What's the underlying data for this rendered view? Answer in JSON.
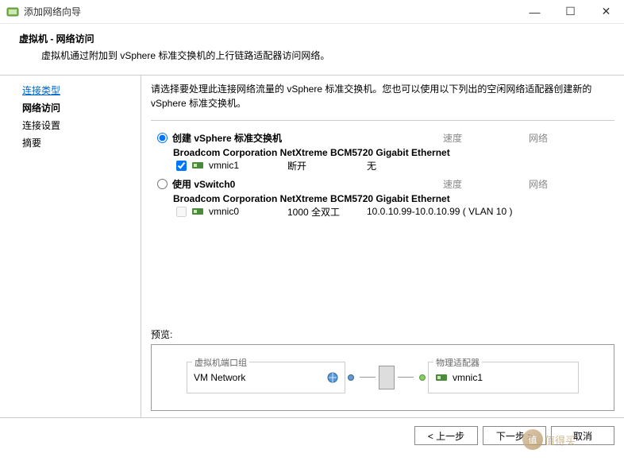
{
  "window": {
    "title": "添加网络向导",
    "minimize": "—",
    "maximize": "☐",
    "close": "✕"
  },
  "header": {
    "title": "虚拟机 - 网络访问",
    "description": "虚拟机通过附加到 vSphere 标准交换机的上行链路适配器访问网络。"
  },
  "sidebar": {
    "items": [
      {
        "label": "连接类型",
        "type": "link"
      },
      {
        "label": "网络访问",
        "type": "active"
      },
      {
        "label": "连接设置",
        "type": "normal"
      },
      {
        "label": "摘要",
        "type": "normal"
      }
    ]
  },
  "content": {
    "description": "请选择要处理此连接网络流量的 vSphere 标准交换机。您也可以使用以下列出的空闲网络适配器创建新的 vSphere 标准交换机。",
    "col_speed": "速度",
    "col_network": "网络",
    "options": [
      {
        "radio_label": "创建 vSphere 标准交换机",
        "selected": true,
        "adapter": "Broadcom Corporation NetXtreme BCM5720 Gigabit Ethernet",
        "nic": {
          "checked": true,
          "name": "vmnic1",
          "speed": "断开",
          "network": "无"
        }
      },
      {
        "radio_label": "使用 vSwitch0",
        "selected": false,
        "adapter": "Broadcom Corporation NetXtreme BCM5720 Gigabit Ethernet",
        "nic": {
          "checked": false,
          "name": "vmnic0",
          "speed": "1000 全双工",
          "network": "10.0.10.99-10.0.10.99 ( VLAN 10 )"
        }
      }
    ],
    "preview_label": "预览:",
    "preview": {
      "port_group_label": "虚拟机端口组",
      "port_group_name": "VM Network",
      "adapter_label": "物理适配器",
      "adapter_name": "vmnic1"
    }
  },
  "buttons": {
    "back": "< 上一步",
    "next": "下一步 >",
    "cancel": "取消"
  },
  "watermark": "值得买"
}
